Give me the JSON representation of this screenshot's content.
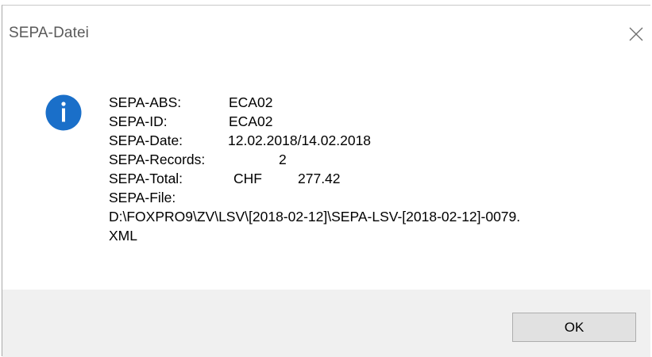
{
  "window": {
    "title": "SEPA-Datei"
  },
  "icons": {
    "close": "close-icon",
    "info": "info-icon"
  },
  "colors": {
    "info_icon": "#1a6fc9",
    "footer_bg": "#f0f0f0",
    "button_bg": "#e1e1e1"
  },
  "message": {
    "abs_label": "SEPA-ABS:",
    "abs_value": "ECA02",
    "id_label": "SEPA-ID:",
    "id_value": "ECA02",
    "date_label": "SEPA-Date:",
    "date_value": "12.02.2018/14.02.2018",
    "records_label": "SEPA-Records:",
    "records_value": "2",
    "total_label": "SEPA-Total:",
    "total_currency": "CHF",
    "total_value": "277.42",
    "file_label": "SEPA-File:",
    "file_path_line1": "D:\\FOXPRO9\\ZV\\LSV\\[2018-02-12]\\SEPA-LSV-[2018-02-12]-0079.",
    "file_path_line2": "XML"
  },
  "buttons": {
    "ok_label": "OK"
  }
}
